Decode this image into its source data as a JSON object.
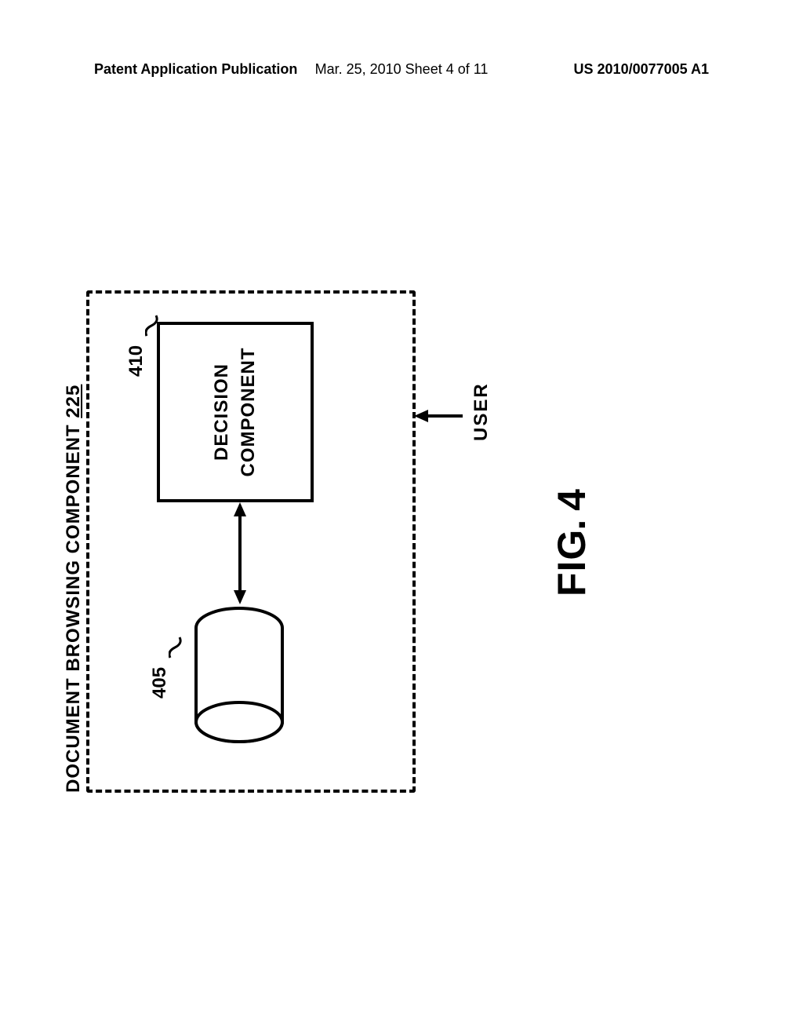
{
  "header": {
    "left": "Patent Application Publication",
    "center": "Mar. 25, 2010  Sheet 4 of 11",
    "right": "US 2010/0077005 A1"
  },
  "diagram": {
    "container_label_prefix": "DOCUMENT BROWSING COMPONENT ",
    "container_label_num": "225",
    "ref_cylinder": "405",
    "decision_label": "DECISION\nCOMPONENT",
    "ref_decision": "410",
    "user_label": "USER",
    "figure_label_prefix": "FIG",
    "figure_label_dot": ".",
    "figure_label_num": " 4"
  }
}
